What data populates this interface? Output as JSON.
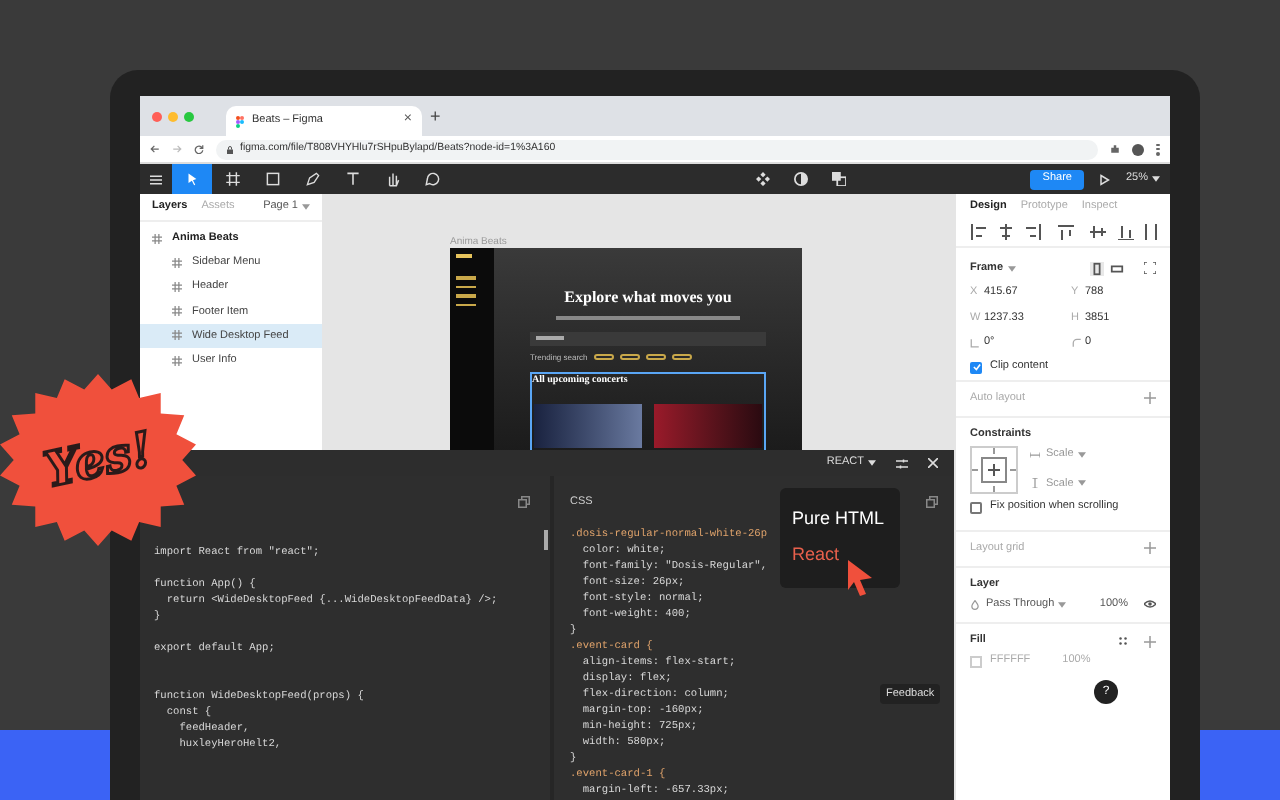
{
  "browser": {
    "tab_title": "Beats – Figma",
    "tab_close": "×",
    "new_tab": "+",
    "url": "figma.com/file/T808VHYHlu7rSHpuBylapd/Beats?node-id=1%3A160"
  },
  "toolbar": {
    "tools": [
      {
        "kind": "move",
        "selected": true
      },
      {
        "kind": "frame",
        "selected": false
      },
      {
        "kind": "rect",
        "selected": false
      },
      {
        "kind": "pen",
        "selected": false
      },
      {
        "kind": "text",
        "selected": false
      },
      {
        "kind": "hand",
        "selected": false
      },
      {
        "kind": "comment",
        "selected": false
      }
    ],
    "share": "Share",
    "zoom": "25%"
  },
  "layers_panel": {
    "tabs": [
      {
        "label": "Layers",
        "selected": true
      },
      {
        "label": "Assets",
        "selected": false
      }
    ],
    "page": "Page 1",
    "layers": [
      {
        "name": "Anima Beats",
        "selected": false,
        "children": [
          {
            "name": "Sidebar Menu",
            "selected": false
          },
          {
            "name": "Header",
            "selected": false
          },
          {
            "name": "Footer Item",
            "selected": false
          },
          {
            "name": "Wide Desktop Feed",
            "selected": true
          },
          {
            "name": "User Info",
            "selected": false
          }
        ]
      }
    ]
  },
  "canvas": {
    "frame_label": "Anima Beats",
    "hero_title": "Explore what moves you",
    "trending_label": "Trending search",
    "section_title": "All upcoming concerts"
  },
  "design_panel": {
    "tabs": [
      {
        "label": "Design",
        "selected": true
      },
      {
        "label": "Prototype",
        "selected": false
      },
      {
        "label": "Inspect",
        "selected": false
      }
    ],
    "frame_label": "Frame",
    "fields": [
      {
        "kind": "text",
        "label": "X",
        "value": "415.67"
      },
      {
        "kind": "text",
        "label": "Y",
        "value": "788"
      },
      {
        "kind": "text",
        "label": "W",
        "value": "1237.33"
      },
      {
        "kind": "text",
        "label": "H",
        "value": "3851"
      },
      {
        "kind": "rotation",
        "value": "0°"
      },
      {
        "kind": "radius",
        "value": "0"
      }
    ],
    "clip_content": {
      "label": "Clip content",
      "checked": true
    },
    "auto_layout": "Auto layout",
    "constraints": "Constraints",
    "scales": [
      "Scale",
      "Scale"
    ],
    "fix_position": {
      "label": "Fix position when scrolling",
      "checked": false
    },
    "layout_grid": "Layout grid",
    "layer": "Layer",
    "blend": "Pass Through",
    "layer_opacity": "100%",
    "fill": "Fill",
    "fill_hex": "FFFFFF",
    "fill_opacity": "100%",
    "help": "?"
  },
  "code_panel": {
    "framework": "REACT",
    "css_label": "CSS",
    "feedback": "Feedback",
    "menu": [
      {
        "label": "Pure HTML",
        "selected": false
      },
      {
        "label": "React",
        "selected": true
      }
    ],
    "js_lines": [
      {
        "kind": "code",
        "text": "import React from \"react\";"
      },
      {
        "kind": "blank"
      },
      {
        "kind": "code",
        "text": "function App() {"
      },
      {
        "kind": "code",
        "text": "  return <WideDesktopFeed {...WideDesktopFeedData} />;"
      },
      {
        "kind": "code",
        "text": "}"
      },
      {
        "kind": "blank"
      },
      {
        "kind": "code",
        "text": "export default App;"
      },
      {
        "kind": "blank"
      },
      {
        "kind": "blank"
      },
      {
        "kind": "code",
        "text": "function WideDesktopFeed(props) {"
      },
      {
        "kind": "code",
        "text": "  const {"
      },
      {
        "kind": "code",
        "text": "    feedHeader,"
      },
      {
        "kind": "code",
        "text": "    huxleyHeroHelt2,"
      }
    ],
    "css_lines": [
      {
        "kind": "selector",
        "text": ".dosis-regular-normal-white-26p"
      },
      {
        "kind": "code",
        "text": "  color: white;"
      },
      {
        "kind": "code",
        "text": "  font-family: \"Dosis-Regular\","
      },
      {
        "kind": "code",
        "text": "  font-size: 26px;"
      },
      {
        "kind": "code",
        "text": "  font-style: normal;"
      },
      {
        "kind": "code",
        "text": "  font-weight: 400;"
      },
      {
        "kind": "code",
        "text": "}"
      },
      {
        "kind": "selector",
        "text": ".event-card {"
      },
      {
        "kind": "code",
        "text": "  align-items: flex-start;"
      },
      {
        "kind": "code",
        "text": "  display: flex;"
      },
      {
        "kind": "code",
        "text": "  flex-direction: column;"
      },
      {
        "kind": "code",
        "text": "  margin-top: -160px;"
      },
      {
        "kind": "code",
        "text": "  min-height: 725px;"
      },
      {
        "kind": "code",
        "text": "  width: 580px;"
      },
      {
        "kind": "code",
        "text": "}"
      },
      {
        "kind": "selector",
        "text": ".event-card-1 {"
      },
      {
        "kind": "code",
        "text": "  margin-left: -657.33px;"
      }
    ]
  },
  "badge": {
    "text": "Yes!"
  }
}
